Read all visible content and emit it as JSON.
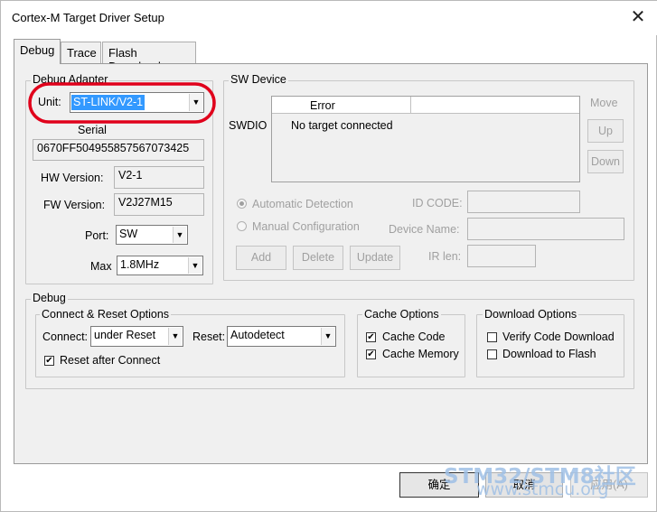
{
  "window": {
    "title": "Cortex-M Target Driver Setup",
    "close_glyph": "✕"
  },
  "tabs": [
    "Debug",
    "Trace",
    "Flash Download"
  ],
  "debug_adapter": {
    "label": "Debug Adapter",
    "unit_label": "Unit:",
    "unit_value": "ST-LINK/V2-1",
    "serial_label": "Serial",
    "serial_value": "0670FF504955857567073425",
    "hw_label": "HW Version:",
    "hw_value": "V2-1",
    "fw_label": "FW Version:",
    "fw_value": "V2J27M15",
    "port_label": "Port:",
    "port_value": "SW",
    "max_label": "Max",
    "max_value": "1.8MHz"
  },
  "sw_device": {
    "label": "SW Device",
    "swdio_label": "SWDIO",
    "col_error": "Error",
    "message": "No target connected",
    "move_label": "Move",
    "up_label": "Up",
    "down_label": "Down",
    "auto_label": "Automatic Detection",
    "manual_label": "Manual Configuration",
    "id_code_label": "ID CODE:",
    "device_name_label": "Device Name:",
    "ir_len_label": "IR len:",
    "add_label": "Add",
    "delete_label": "Delete",
    "update_label": "Update"
  },
  "debug": {
    "label": "Debug",
    "connect_reset": {
      "label": "Connect & Reset Options",
      "connect_label": "Connect:",
      "connect_value": "under Reset",
      "reset_label": "Reset:",
      "reset_value": "Autodetect",
      "reset_after_label": "Reset after Connect",
      "reset_after_checked": true
    },
    "cache": {
      "label": "Cache Options",
      "cache_code_label": "Cache Code",
      "cache_code_checked": true,
      "cache_memory_label": "Cache Memory",
      "cache_memory_checked": true
    },
    "download": {
      "label": "Download Options",
      "verify_label": "Verify Code Download",
      "verify_checked": false,
      "flash_label": "Download to Flash",
      "flash_checked": false
    }
  },
  "footer": {
    "ok_label": "确定",
    "cancel_label": "取消",
    "apply_label": "应用(A)"
  },
  "watermark": {
    "line1": "STM32/STM8社区",
    "line2": "www.stmcu.org"
  },
  "colors": {
    "highlight_oval": "#e0001b",
    "selection": "#3399ff",
    "watermark": "#9fc0e6"
  }
}
